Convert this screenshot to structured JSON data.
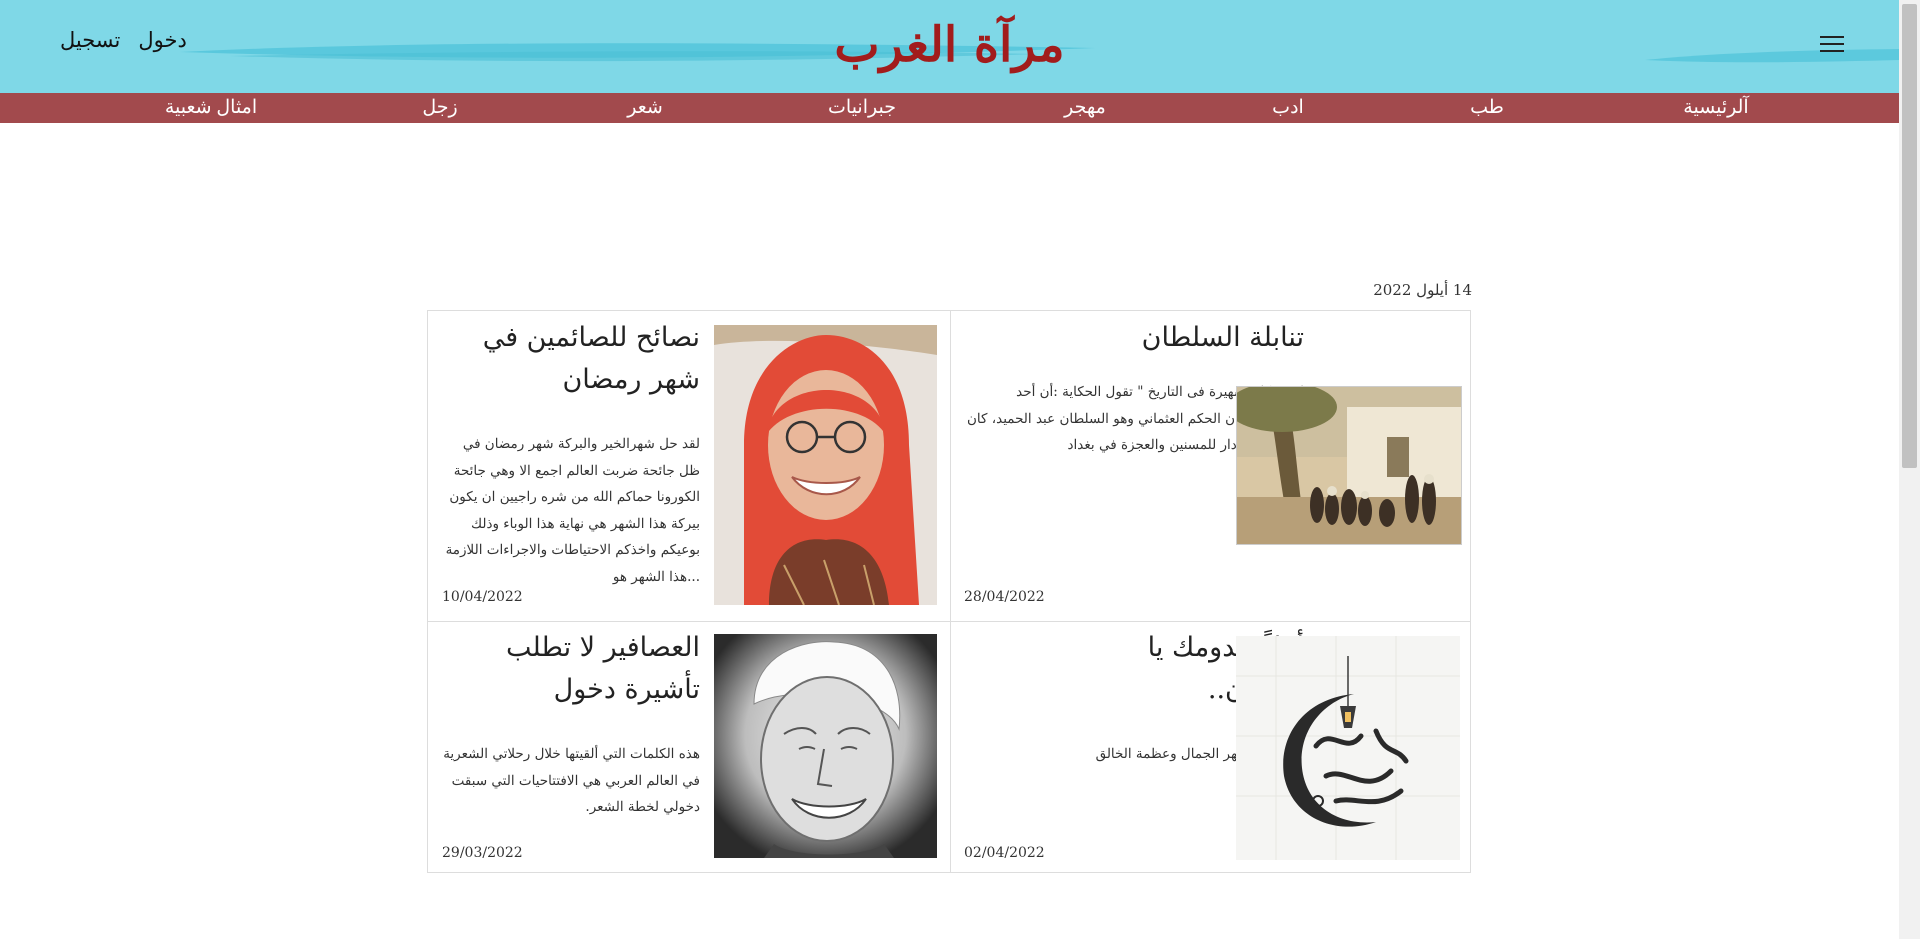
{
  "header": {
    "site_title": "مرآة الغرب",
    "auth": {
      "login": "دخول",
      "register": "تسجيل"
    },
    "background_color": "#7fd8e7",
    "title_color": "#a21c1c",
    "menu_icon": "hamburger-menu-icon"
  },
  "nav": {
    "background_color": "#a24a4d",
    "items": [
      {
        "label": "آلرئيسية"
      },
      {
        "label": "طب"
      },
      {
        "label": "ادب"
      },
      {
        "label": "مهجر"
      },
      {
        "label": "جبرانيات"
      },
      {
        "label": "شعر"
      },
      {
        "label": "زجل"
      },
      {
        "label": "امثال شعبية"
      }
    ]
  },
  "main": {
    "date": "14 أيلول 2022",
    "articles": [
      {
        "title": "تنابلة السلطان",
        "excerpt": "لهم حكاية شهيرة فى التاريخ \" تقول الحكاية :أن أحد السلاطين إبان الحكم العثماني وهو السلطان عبد الحميد، كان قد أمر ببناء دار للمسنين والعجزة في بغداد",
        "date": "28/04/2022",
        "image": "historical-painting-crowd-image"
      },
      {
        "title": "نصائح للصائمين في شهر رمضان",
        "excerpt": "لقد حل شهرالخير والبركة شهر رمضان في ظل جائحة ضربت العالم اجمع الا وهي جائحة الكورونا حماكم الله من شره راجيين ان يكون بيركة هذا الشهر هي نهاية هذا الوباء وذلك بوعيكم واخذكم الاحتياطات والاجراءات اللازمة ...هذا الشهر هو",
        "date": "10/04/2022",
        "image": "woman-red-hijab-portrait-image"
      },
      {
        "title": "أهلاً بقدومك يا رمضان..",
        "excerpt": "أهلا بك .. شهر الجمال وعظمة الخالق",
        "date": "02/04/2022",
        "image": "ramadan-kareem-calligraphy-image"
      },
      {
        "title": "العصافير لا تطلب تأشيرة دخول",
        "excerpt": "هذه الكلمات التي ألقيتها خلال رحلاتي الشعرية في العالم العربي هي الافتتاحيات التي سبقت دخولي لخطة الشعر.",
        "date": "29/03/2022",
        "image": "elderly-man-portrait-image"
      }
    ]
  }
}
